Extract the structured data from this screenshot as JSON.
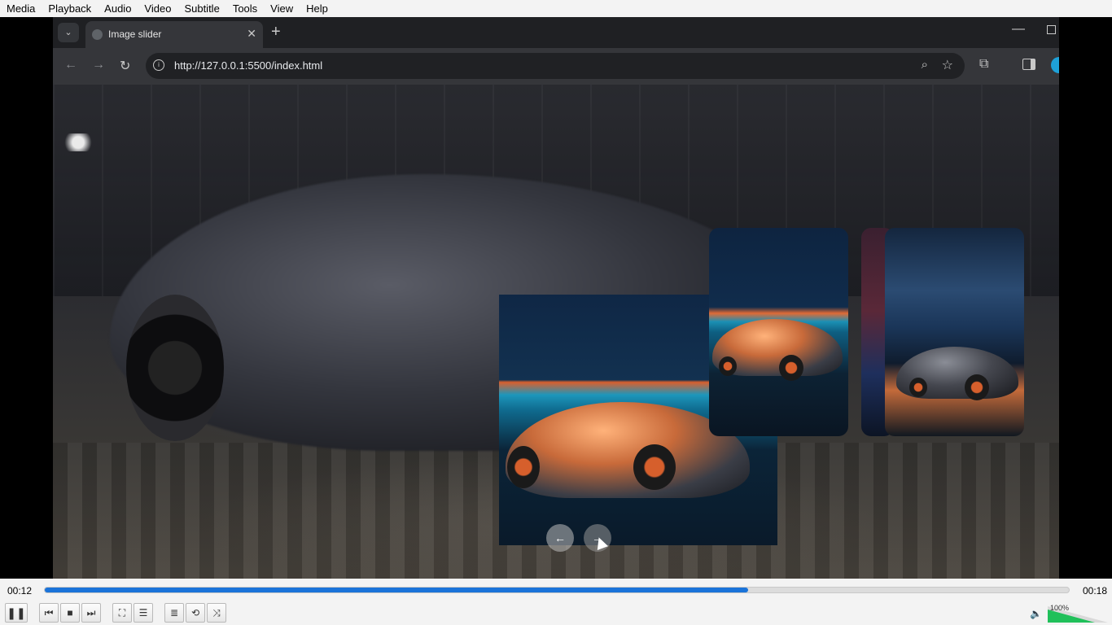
{
  "menubar": {
    "items": [
      "Media",
      "Playback",
      "Audio",
      "Video",
      "Subtitle",
      "Tools",
      "View",
      "Help"
    ]
  },
  "browser": {
    "tab_title": "Image slider",
    "url": "http://127.0.0.1:5500/index.html"
  },
  "player": {
    "elapsed": "00:12",
    "total": "00:18",
    "progress_fraction": 0.687,
    "volume_label": "100%",
    "volume_fraction": 0.78
  },
  "icons": {
    "play_pause": "pause-icon",
    "prev": "previous-icon",
    "stop": "stop-icon",
    "next": "next-icon",
    "fullscreen": "fullscreen-icon",
    "extended": "equalizer-icon",
    "playlist": "playlist-icon",
    "loop": "loop-icon",
    "random": "shuffle-icon",
    "speaker": "speaker-icon"
  },
  "colors": {
    "seek_fill": "#1a73d9",
    "volume_fill": "#20c05a"
  }
}
